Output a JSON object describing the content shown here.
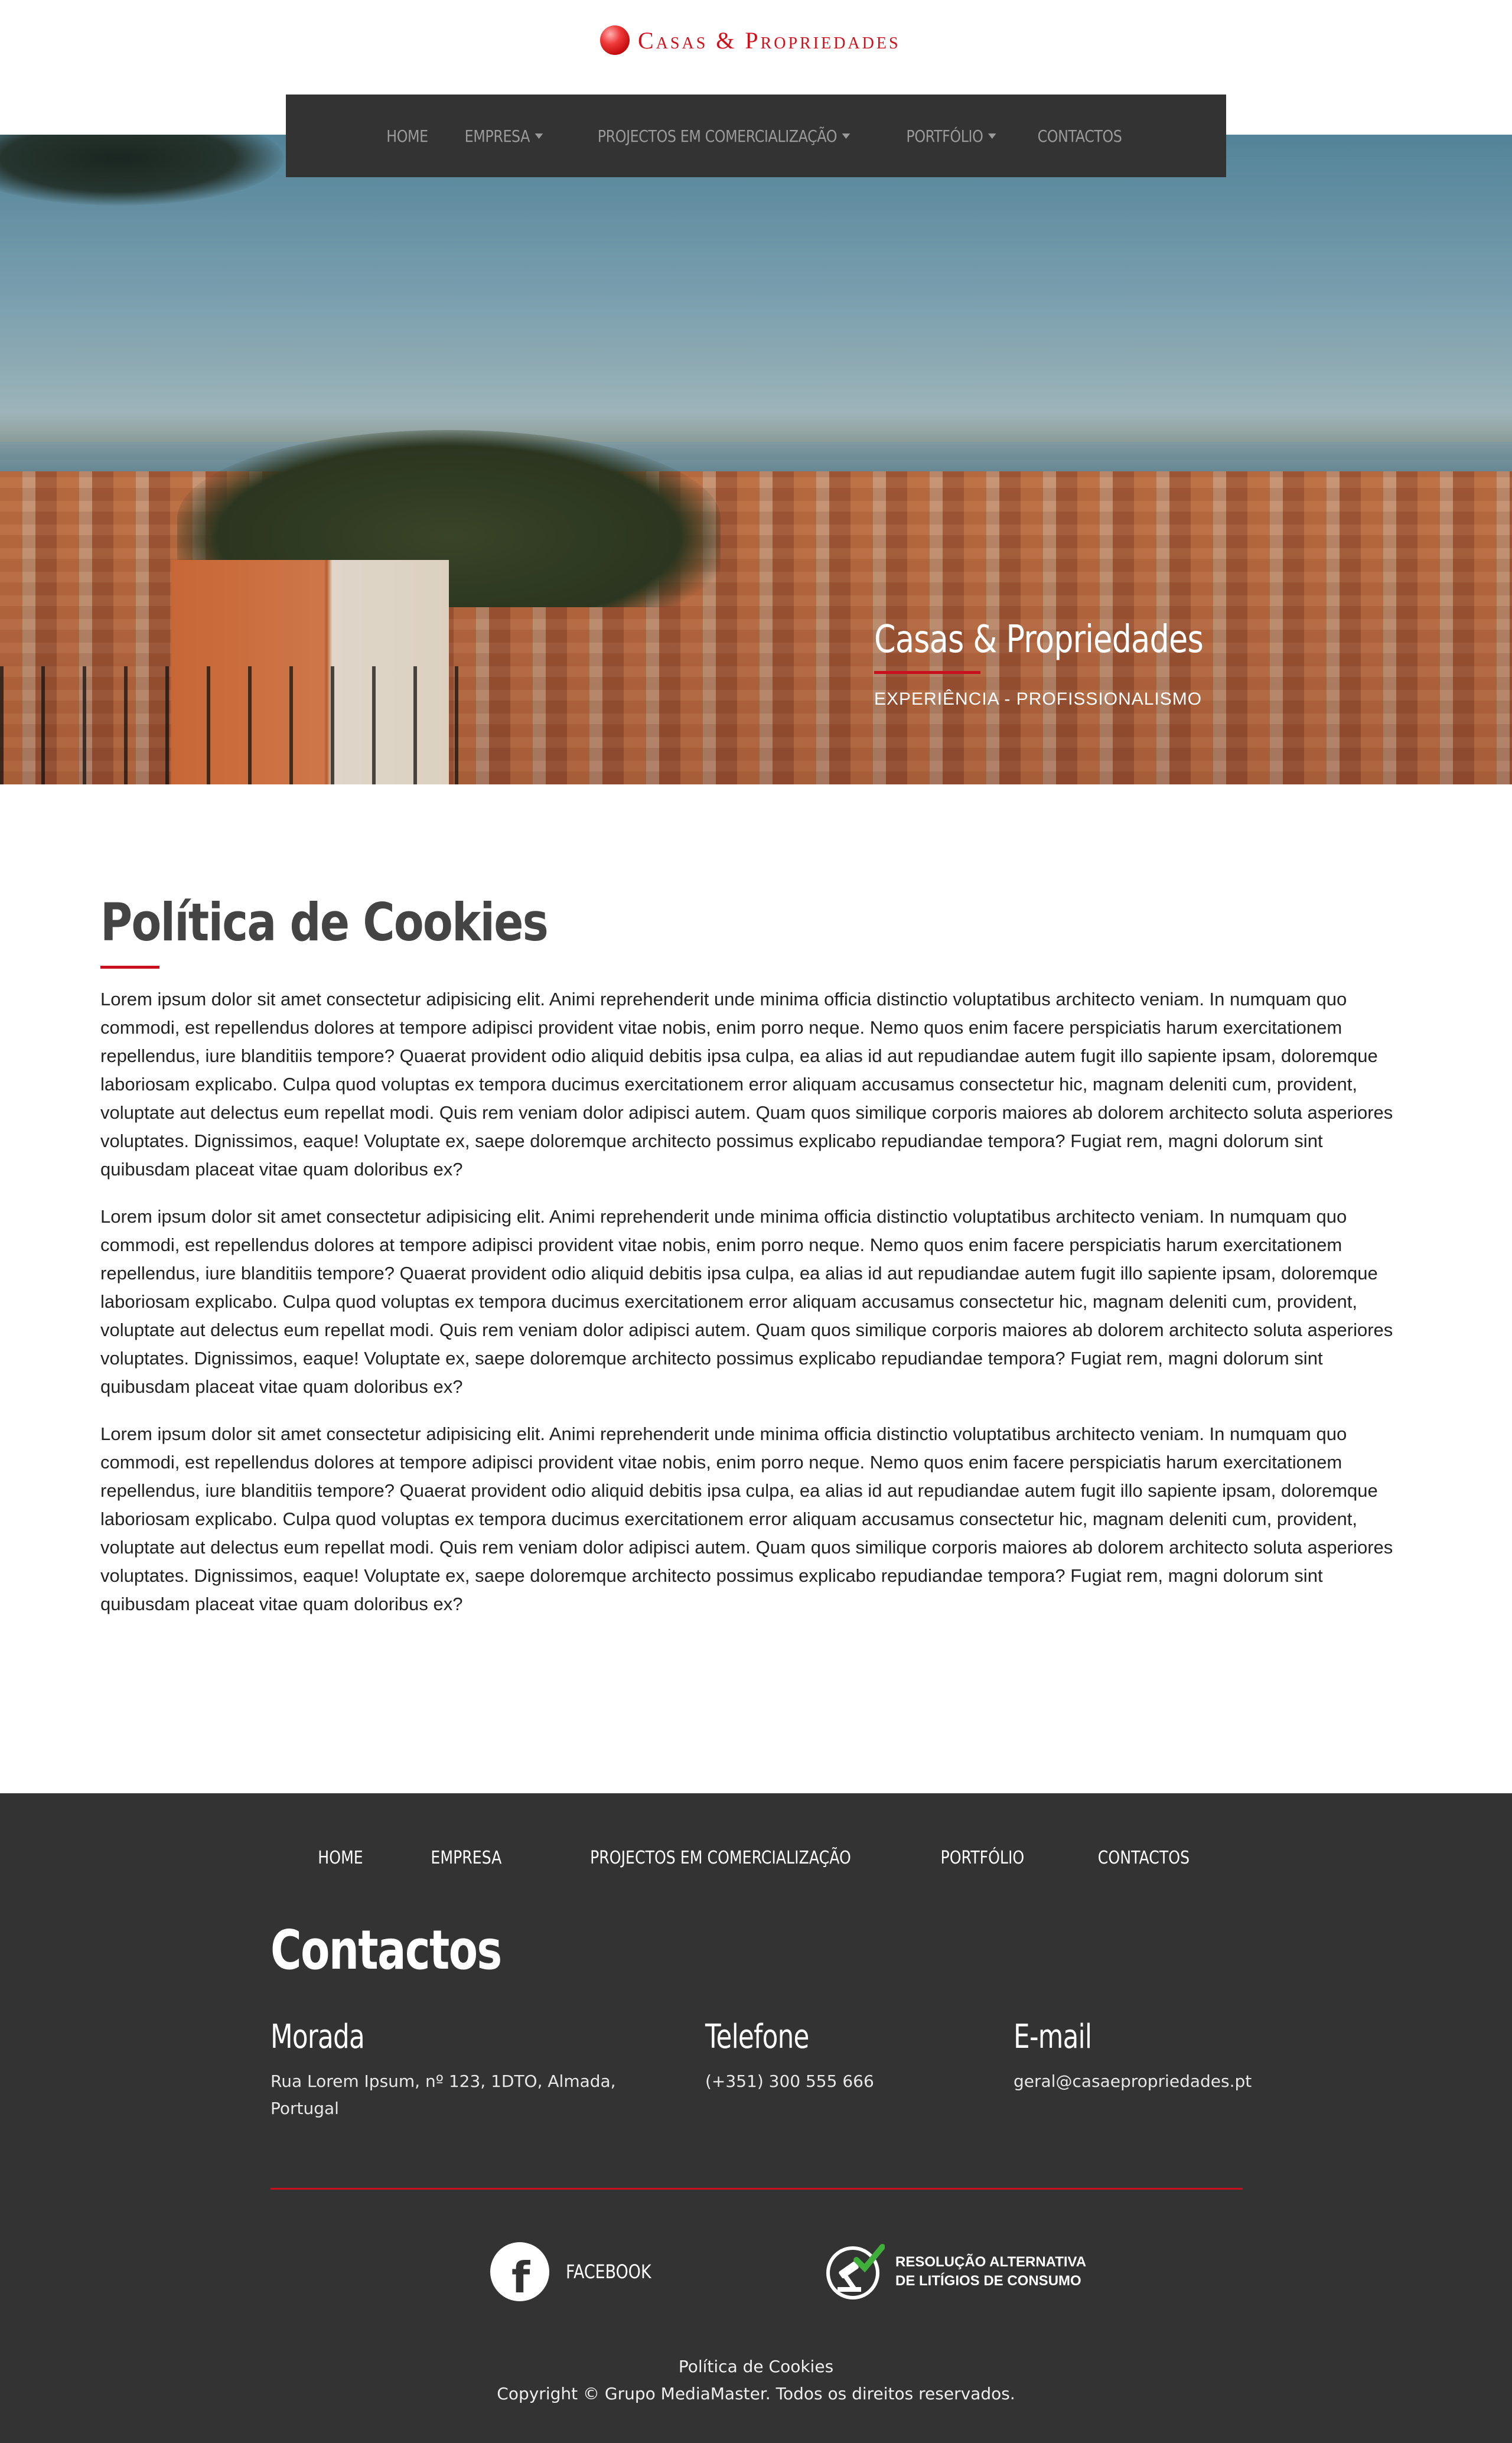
{
  "brand": {
    "name": "Casas & Propriedades",
    "logo_icon": "red-sphere-logo",
    "accent_color": "#c8101e",
    "dark_color": "#333333"
  },
  "nav": {
    "items": [
      {
        "label": "HOME",
        "dropdown": false
      },
      {
        "label": "EMPRESA",
        "dropdown": true
      },
      {
        "label": "PROJECTOS EM COMERCIALIZAÇÃO",
        "dropdown": true
      },
      {
        "label": "PORTFÓLIO",
        "dropdown": true
      },
      {
        "label": "CONTACTOS",
        "dropdown": false
      }
    ]
  },
  "hero": {
    "title": "Casas & Propriedades",
    "subtitle": "EXPERIÊNCIA - PROFISSIONALISMO"
  },
  "content": {
    "title": "Política de Cookies",
    "paragraphs": [
      "Lorem ipsum dolor sit amet consectetur adipisicing elit. Animi reprehenderit unde minima officia distinctio voluptatibus architecto veniam. In numquam quo commodi, est repellendus dolores at tempore adipisci provident vitae nobis, enim porro neque. Nemo quos enim facere perspiciatis harum exercitationem repellendus, iure blanditiis tempore? Quaerat provident odio aliquid debitis ipsa culpa, ea alias id aut repudiandae autem fugit illo sapiente ipsam, doloremque laboriosam explicabo. Culpa quod voluptas ex tempora ducimus exercitationem error aliquam accusamus consectetur hic, magnam deleniti cum, provident, voluptate aut delectus eum repellat modi. Quis rem veniam dolor adipisci autem. Quam quos similique corporis maiores ab dolorem architecto soluta asperiores voluptates. Dignissimos, eaque! Voluptate ex, saepe doloremque architecto possimus explicabo repudiandae tempora? Fugiat rem, magni dolorum sint quibusdam placeat vitae quam doloribus ex?",
      "Lorem ipsum dolor sit amet consectetur adipisicing elit. Animi reprehenderit unde minima officia distinctio voluptatibus architecto veniam. In numquam quo commodi, est repellendus dolores at tempore adipisci provident vitae nobis, enim porro neque. Nemo quos enim facere perspiciatis harum exercitationem repellendus, iure blanditiis tempore? Quaerat provident odio aliquid debitis ipsa culpa, ea alias id aut repudiandae autem fugit illo sapiente ipsam, doloremque laboriosam explicabo. Culpa quod voluptas ex tempora ducimus exercitationem error aliquam accusamus consectetur hic, magnam deleniti cum, provident, voluptate aut delectus eum repellat modi. Quis rem veniam dolor adipisci autem. Quam quos similique corporis maiores ab dolorem architecto soluta asperiores voluptates. Dignissimos, eaque! Voluptate ex, saepe doloremque architecto possimus explicabo repudiandae tempora? Fugiat rem, magni dolorum sint quibusdam placeat vitae quam doloribus ex?",
      "Lorem ipsum dolor sit amet consectetur adipisicing elit. Animi reprehenderit unde minima officia distinctio voluptatibus architecto veniam. In numquam quo commodi, est repellendus dolores at tempore adipisci provident vitae nobis, enim porro neque. Nemo quos enim facere perspiciatis harum exercitationem repellendus, iure blanditiis tempore? Quaerat provident odio aliquid debitis ipsa culpa, ea alias id aut repudiandae autem fugit illo sapiente ipsam, doloremque laboriosam explicabo. Culpa quod voluptas ex tempora ducimus exercitationem error aliquam accusamus consectetur hic, magnam deleniti cum, provident, voluptate aut delectus eum repellat modi. Quis rem veniam dolor adipisci autem. Quam quos similique corporis maiores ab dolorem architecto soluta asperiores voluptates. Dignissimos, eaque! Voluptate ex, saepe doloremque architecto possimus explicabo repudiandae tempora? Fugiat rem, magni dolorum sint quibusdam placeat vitae quam doloribus ex?"
    ]
  },
  "footer": {
    "nav": [
      "HOME",
      "EMPRESA",
      "PROJECTOS EM COMERCIALIZAÇÃO",
      "PORTFÓLIO",
      "CONTACTOS"
    ],
    "title": "Contactos",
    "address": {
      "heading": "Morada",
      "value": "Rua Lorem Ipsum, nº 123, 1DTO, Almada, Portugal"
    },
    "phone": {
      "heading": "Telefone",
      "value": "(+351) 300 555 666"
    },
    "email": {
      "heading": "E-mail",
      "value": "geral@casaepropriedades.pt"
    },
    "facebook": {
      "label": "FACEBOOK",
      "icon": "facebook-icon"
    },
    "ral": {
      "line1": "RESOLUÇÃO ALTERNATIVA",
      "line2": "DE LITÍGIOS DE CONSUMO",
      "icon": "gavel-check-icon"
    },
    "cookies_link": "Política de Cookies",
    "copyright": "Copyright © Grupo MediaMaster. Todos os direitos reservados."
  }
}
